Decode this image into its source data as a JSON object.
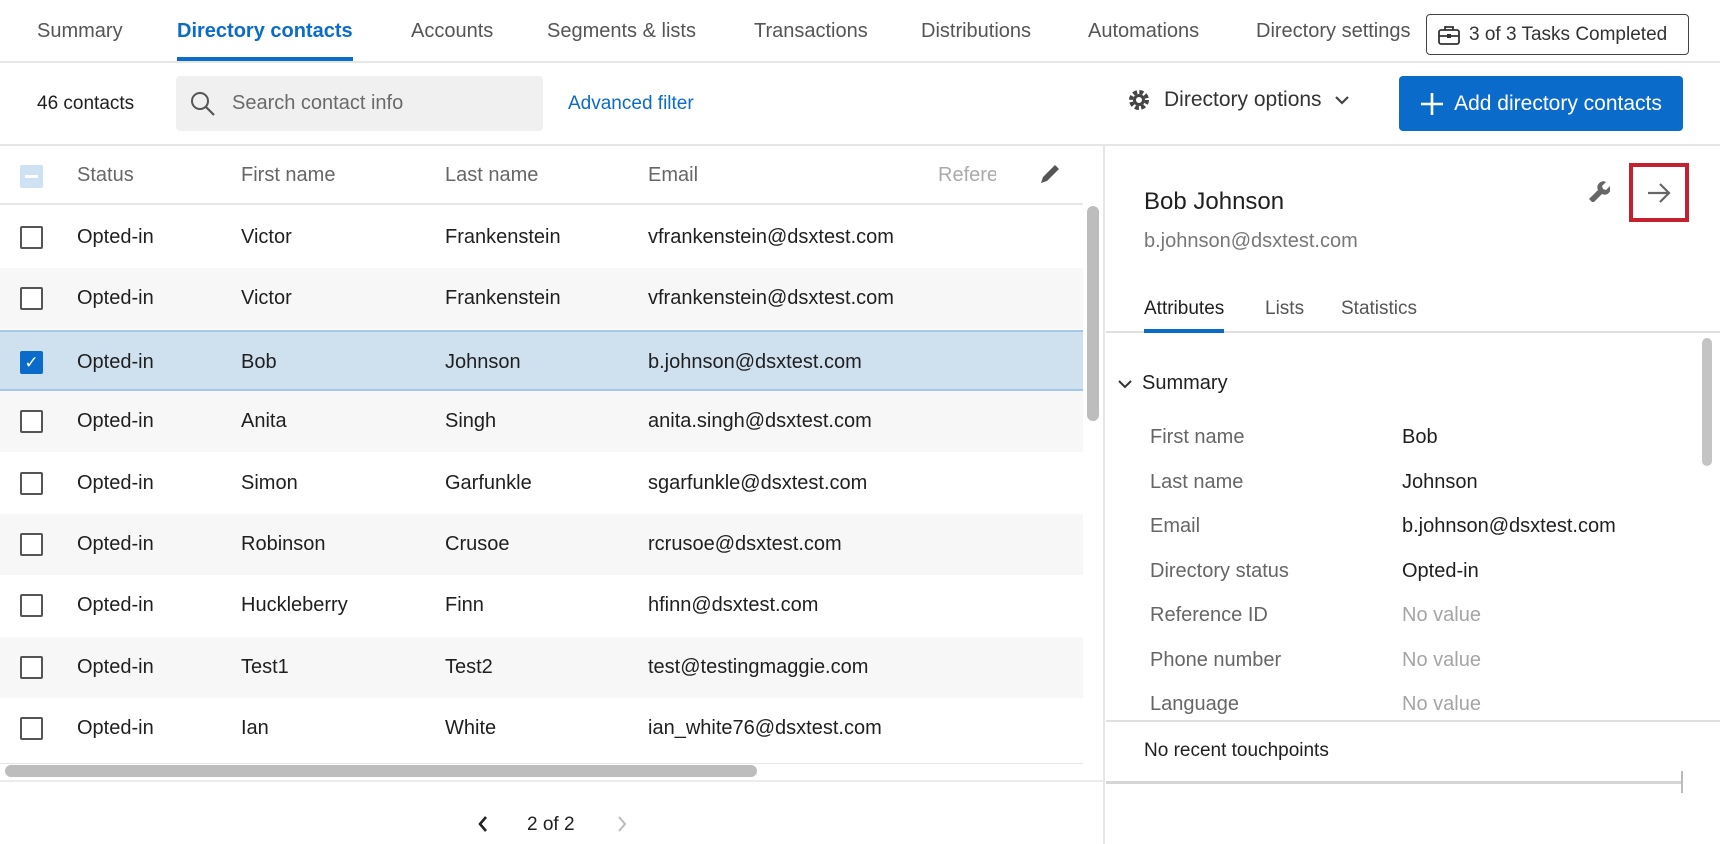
{
  "tabs": [
    "Summary",
    "Directory contacts",
    "Accounts",
    "Segments & lists",
    "Transactions",
    "Distributions",
    "Automations",
    "Directory settings"
  ],
  "active_tab": "Directory contacts",
  "tasks_label": "3 of 3 Tasks Completed",
  "toolbar": {
    "count": "46 contacts",
    "search_placeholder": "Search contact info",
    "advanced_filter": "Advanced filter",
    "directory_options": "Directory options",
    "add_button": "Add directory contacts"
  },
  "table": {
    "headers": [
      "Status",
      "First name",
      "Last name",
      "Email",
      "Refere"
    ],
    "rows": [
      {
        "status": "Opted-in",
        "first": "Victor",
        "last": "Frankenstein",
        "email": "vfrankenstein@dsxtest.com",
        "checked": false
      },
      {
        "status": "Opted-in",
        "first": "Victor",
        "last": "Frankenstein",
        "email": "vfrankenstein@dsxtest.com",
        "checked": false
      },
      {
        "status": "Opted-in",
        "first": "Bob",
        "last": "Johnson",
        "email": "b.johnson@dsxtest.com",
        "checked": true
      },
      {
        "status": "Opted-in",
        "first": "Anita",
        "last": "Singh",
        "email": "anita.singh@dsxtest.com",
        "checked": false
      },
      {
        "status": "Opted-in",
        "first": "Simon",
        "last": "Garfunkle",
        "email": "sgarfunkle@dsxtest.com",
        "checked": false
      },
      {
        "status": "Opted-in",
        "first": "Robinson",
        "last": "Crusoe",
        "email": "rcrusoe@dsxtest.com",
        "checked": false
      },
      {
        "status": "Opted-in",
        "first": "Huckleberry",
        "last": "Finn",
        "email": "hfinn@dsxtest.com",
        "checked": false
      },
      {
        "status": "Opted-in",
        "first": "Test1",
        "last": "Test2",
        "email": "test@testingmaggie.com",
        "checked": false
      },
      {
        "status": "Opted-in",
        "first": "Ian",
        "last": "White",
        "email": "ian_white76@dsxtest.com",
        "checked": false
      }
    ]
  },
  "pagination": {
    "label": "2 of 2"
  },
  "panel": {
    "name": "Bob Johnson",
    "email": "b.johnson@dsxtest.com",
    "tabs": [
      "Attributes",
      "Lists",
      "Statistics"
    ],
    "section": "Summary",
    "attributes": [
      {
        "label": "First name",
        "value": "Bob",
        "empty": false
      },
      {
        "label": "Last name",
        "value": "Johnson",
        "empty": false
      },
      {
        "label": "Email",
        "value": "b.johnson@dsxtest.com",
        "empty": false
      },
      {
        "label": "Directory status",
        "value": "Opted-in",
        "empty": false
      },
      {
        "label": "Reference ID",
        "value": "No value",
        "empty": true
      },
      {
        "label": "Phone number",
        "value": "No value",
        "empty": true
      },
      {
        "label": "Language",
        "value": "No value",
        "empty": true
      }
    ],
    "touchpoints": "No recent touchpoints"
  },
  "colors": {
    "accent": "#0b6bcb",
    "highlight": "#c4202f",
    "selected_row": "#cfe0ef"
  }
}
